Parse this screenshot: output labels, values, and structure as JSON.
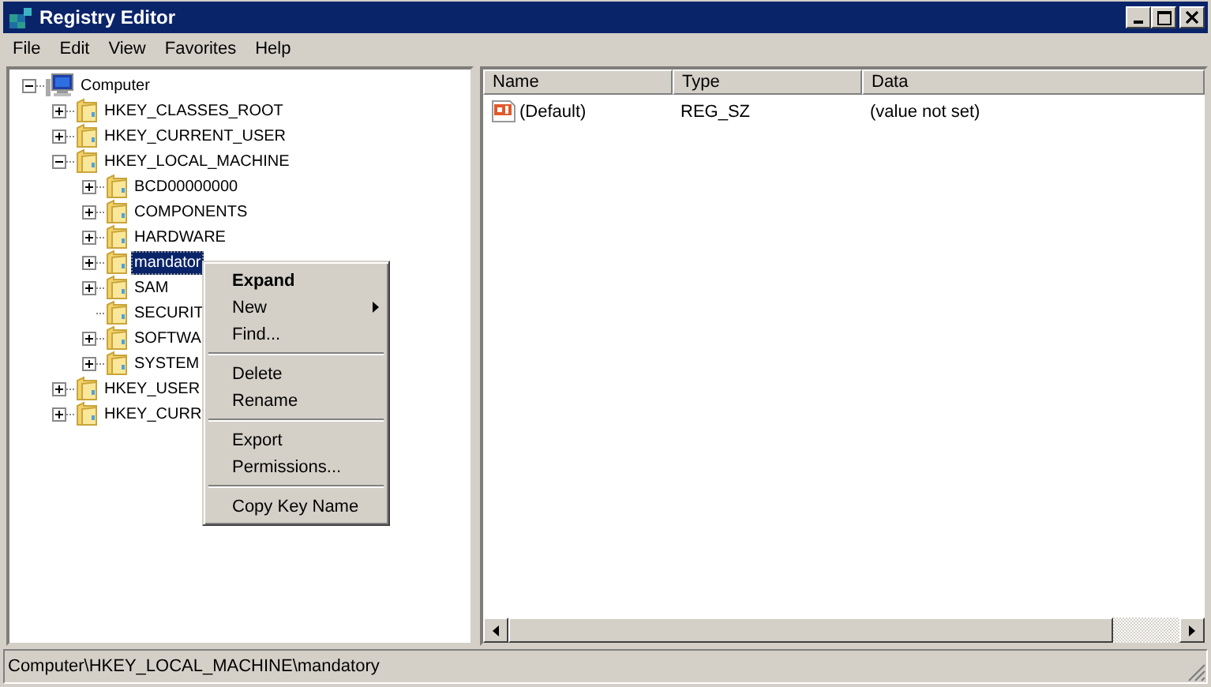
{
  "window": {
    "title": "Registry Editor"
  },
  "menu_bar": [
    "File",
    "Edit",
    "View",
    "Favorites",
    "Help"
  ],
  "tree": [
    {
      "label": "Computer",
      "kind": "computer",
      "expandable": true,
      "expanded": true,
      "selected": false,
      "children": [
        {
          "label": "HKEY_CLASSES_ROOT",
          "kind": "folder",
          "expandable": true,
          "expanded": false,
          "selected": false
        },
        {
          "label": "HKEY_CURRENT_USER",
          "kind": "folder",
          "expandable": true,
          "expanded": false,
          "selected": false
        },
        {
          "label": "HKEY_LOCAL_MACHINE",
          "kind": "folder",
          "expandable": true,
          "expanded": true,
          "selected": false,
          "children": [
            {
              "label": "BCD00000000",
              "kind": "folder",
              "expandable": true,
              "expanded": false,
              "selected": false
            },
            {
              "label": "COMPONENTS",
              "kind": "folder",
              "expandable": true,
              "expanded": false,
              "selected": false
            },
            {
              "label": "HARDWARE",
              "kind": "folder",
              "expandable": true,
              "expanded": false,
              "selected": false
            },
            {
              "label": "mandator",
              "kind": "folder",
              "expandable": true,
              "expanded": false,
              "selected": true
            },
            {
              "label": "SAM",
              "kind": "folder",
              "expandable": true,
              "expanded": false,
              "selected": false
            },
            {
              "label": "SECURIT",
              "kind": "folder",
              "expandable": false,
              "selected": false
            },
            {
              "label": "SOFTWA",
              "kind": "folder",
              "expandable": true,
              "expanded": false,
              "selected": false
            },
            {
              "label": "SYSTEM",
              "kind": "folder",
              "expandable": true,
              "expanded": false,
              "selected": false
            }
          ]
        },
        {
          "label": "HKEY_USER",
          "kind": "folder",
          "expandable": true,
          "expanded": false,
          "selected": false
        },
        {
          "label": "HKEY_CURR",
          "kind": "folder",
          "expandable": true,
          "expanded": false,
          "selected": false
        }
      ]
    }
  ],
  "table": {
    "columns": [
      "Name",
      "Type",
      "Data"
    ],
    "rows": [
      {
        "name": "(Default)",
        "type": "REG_SZ",
        "data": "(value not set)"
      }
    ]
  },
  "context_menu": [
    {
      "kind": "item",
      "label": "Expand",
      "bold": true,
      "submenu": false
    },
    {
      "kind": "item",
      "label": "New",
      "bold": false,
      "submenu": true
    },
    {
      "kind": "item",
      "label": "Find...",
      "bold": false,
      "submenu": false
    },
    {
      "kind": "separator"
    },
    {
      "kind": "item",
      "label": "Delete",
      "bold": false,
      "submenu": false
    },
    {
      "kind": "item",
      "label": "Rename",
      "bold": false,
      "submenu": false
    },
    {
      "kind": "separator"
    },
    {
      "kind": "item",
      "label": "Export",
      "bold": false,
      "submenu": false
    },
    {
      "kind": "item",
      "label": "Permissions...",
      "bold": false,
      "submenu": false
    },
    {
      "kind": "separator"
    },
    {
      "kind": "item",
      "label": "Copy Key Name",
      "bold": false,
      "submenu": false
    }
  ],
  "status_bar": "Computer\\HKEY_LOCAL_MACHINE\\mandatory"
}
